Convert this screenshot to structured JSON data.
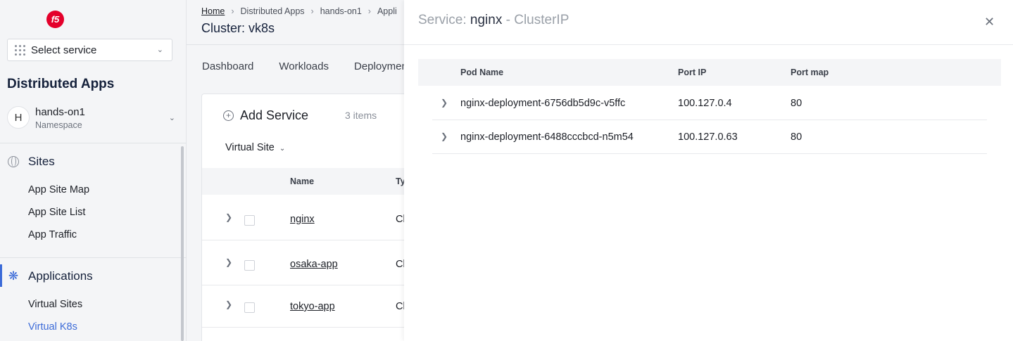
{
  "sidebar": {
    "logo_text": "f5",
    "select_service": "Select service",
    "section_title": "Distributed Apps",
    "namespace": {
      "avatar": "H",
      "name": "hands-on1",
      "label": "Namespace"
    },
    "sites": {
      "heading": "Sites",
      "items": [
        "App Site Map",
        "App Site List",
        "App Traffic"
      ]
    },
    "applications": {
      "heading": "Applications",
      "items": [
        "Virtual Sites",
        "Virtual K8s"
      ]
    }
  },
  "main": {
    "breadcrumb": [
      "Home",
      "Distributed Apps",
      "hands-on1",
      "Appli"
    ],
    "title": "Cluster: vk8s",
    "tabs": [
      "Dashboard",
      "Workloads",
      "Deploymen"
    ],
    "add_service": "Add Service",
    "item_count": "3 items",
    "filter": "Virtual Site",
    "table": {
      "columns": [
        "Name",
        "Ty"
      ],
      "rows": [
        {
          "name": "nginx",
          "type": "Cl"
        },
        {
          "name": "osaka-app",
          "type": "Cl"
        },
        {
          "name": "tokyo-app",
          "type": "Cl"
        }
      ]
    }
  },
  "drawer": {
    "title_prefix": "Service:",
    "service_name": "nginx",
    "title_suffix": "- ClusterIP",
    "columns": [
      "Pod Name",
      "Port IP",
      "Port map"
    ],
    "rows": [
      {
        "pod": "nginx-deployment-6756db5d9c-v5ffc",
        "ip": "100.127.0.4",
        "port": "80"
      },
      {
        "pod": "nginx-deployment-6488cccbcd-n5m54",
        "ip": "100.127.0.63",
        "port": "80"
      }
    ]
  },
  "colors": {
    "accent": "#3c6bd8",
    "brand": "#e4002b"
  }
}
